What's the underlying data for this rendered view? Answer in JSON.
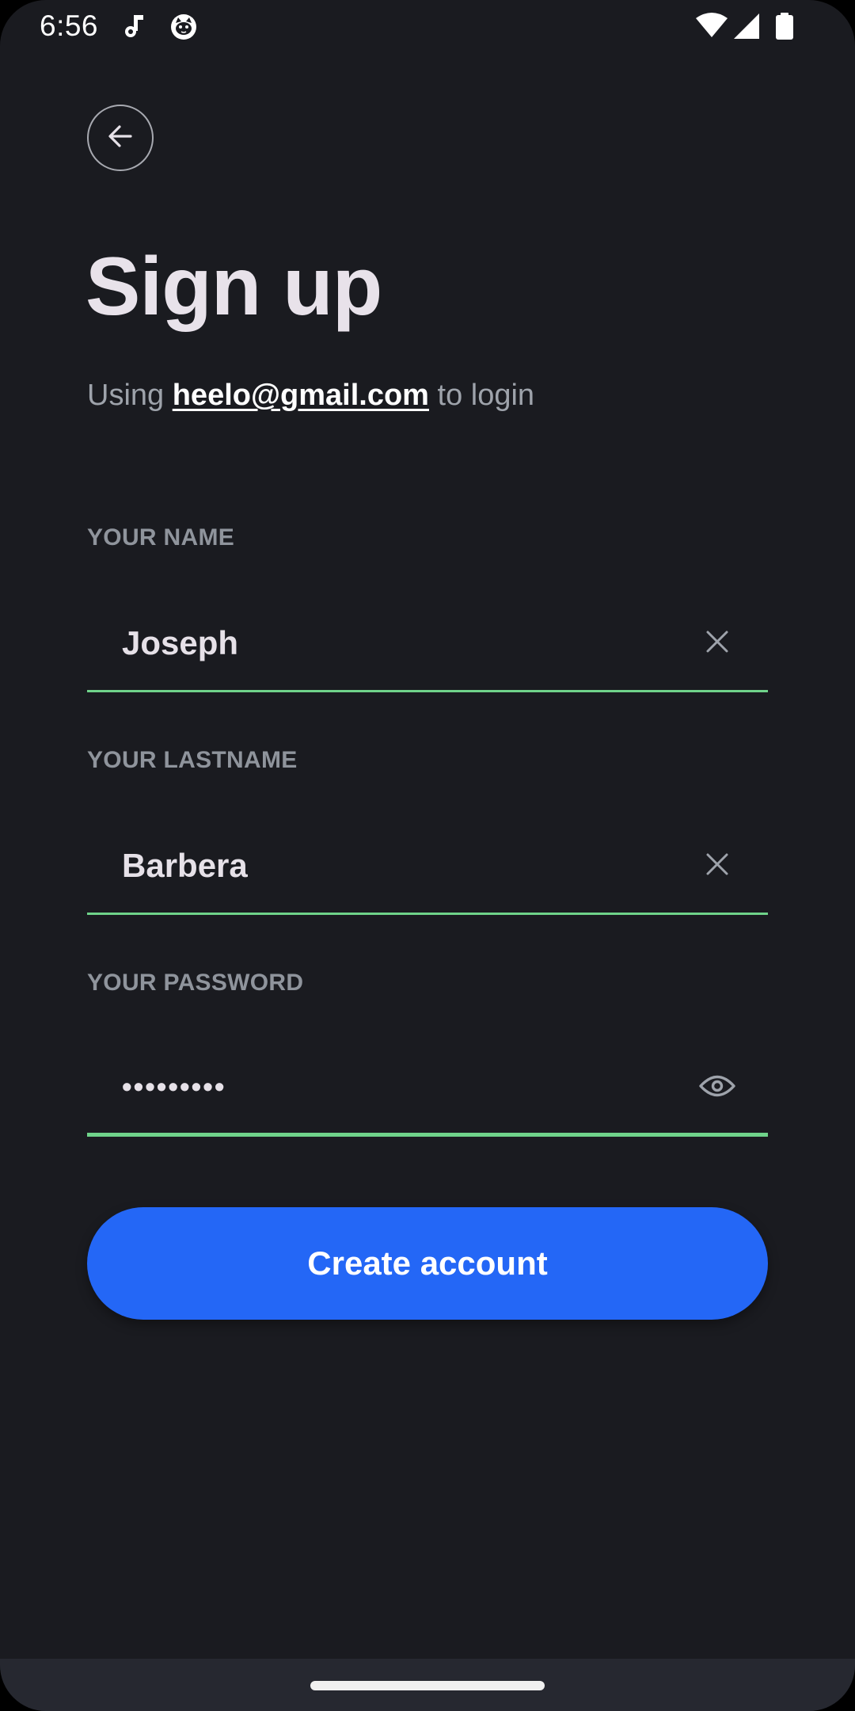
{
  "status_bar": {
    "time": "6:56",
    "icons": [
      "music-note-icon",
      "cat-face-icon",
      "wifi-icon",
      "cell-signal-icon",
      "battery-icon"
    ]
  },
  "header": {
    "back_icon": "arrow-left-icon",
    "title": "Sign up",
    "subtitle_prefix": "Using ",
    "subtitle_email": "heelo@gmail.com",
    "subtitle_suffix": " to login"
  },
  "form": {
    "name": {
      "label": "YOUR NAME",
      "value": "Joseph",
      "action_icon": "clear-icon"
    },
    "lastname": {
      "label": "YOUR LASTNAME",
      "value": "Barbera",
      "action_icon": "clear-icon"
    },
    "password": {
      "label": "YOUR PASSWORD",
      "value": "•••••••••",
      "action_icon": "eye-icon"
    }
  },
  "actions": {
    "create_label": "Create account"
  },
  "colors": {
    "background": "#1a1b20",
    "accent": "#2467f6",
    "underline": "#6fd38a",
    "nav_bar": "#262830"
  }
}
